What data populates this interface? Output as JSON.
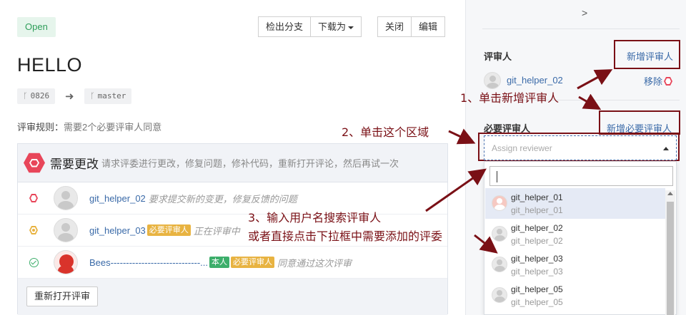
{
  "status": "Open",
  "toolbar": {
    "checkout": "检出分支",
    "download": "下载为",
    "close": "关闭",
    "edit": "编辑"
  },
  "title": "HELLO",
  "branches": {
    "source": "0826",
    "target": "master"
  },
  "rules": {
    "label": "评审规则：",
    "value": "需要2个必要评审人同意"
  },
  "review_panel": {
    "title": "需要更改",
    "description": "请求评委进行更改，修复问题，修补代码，重新打开评论，然后再试一次",
    "rows": [
      {
        "user": "git_helper_02",
        "tags": [],
        "note": "要求提交新的变更，修复反馈的问题"
      },
      {
        "user": "git_helper_03",
        "tags": [
          "必要评审人"
        ],
        "note": "正在评审中"
      },
      {
        "user": "Bees-----------------------------...",
        "tags": [
          "本人",
          "必要评审人"
        ],
        "note": "同意通过这次评审"
      }
    ],
    "reopen_button": "重新打开评审"
  },
  "sidebar": {
    "collapse_icon": ">",
    "reviewers_heading": "评审人",
    "add_reviewer": "新增评审人",
    "reviewer_name": "git_helper_02",
    "remove": "移除",
    "required_heading": "必要评审人",
    "add_required_reviewer": "新增必要评审人",
    "assign_placeholder": "Assign reviewer",
    "search_value": "",
    "options": [
      {
        "name": "git_helper_01",
        "sub": "git_helper_01"
      },
      {
        "name": "git_helper_02",
        "sub": "git_helper_02"
      },
      {
        "name": "git_helper_03",
        "sub": "git_helper_03"
      },
      {
        "name": "git_helper_05",
        "sub": "git_helper_05"
      }
    ]
  },
  "annotations": {
    "step1": "1、单击新增评审人",
    "step2": "2、单击这个区域",
    "step3_line1": "3、输入用户名搜索评审人",
    "step3_line2": "或者直接点击下拉框中需要添加的评委"
  },
  "colors": {
    "accent_link": "#3a6aa8",
    "danger": "#e8465a",
    "warning": "#e8b341",
    "success": "#3dae6b",
    "annotation": "#7a1016"
  }
}
